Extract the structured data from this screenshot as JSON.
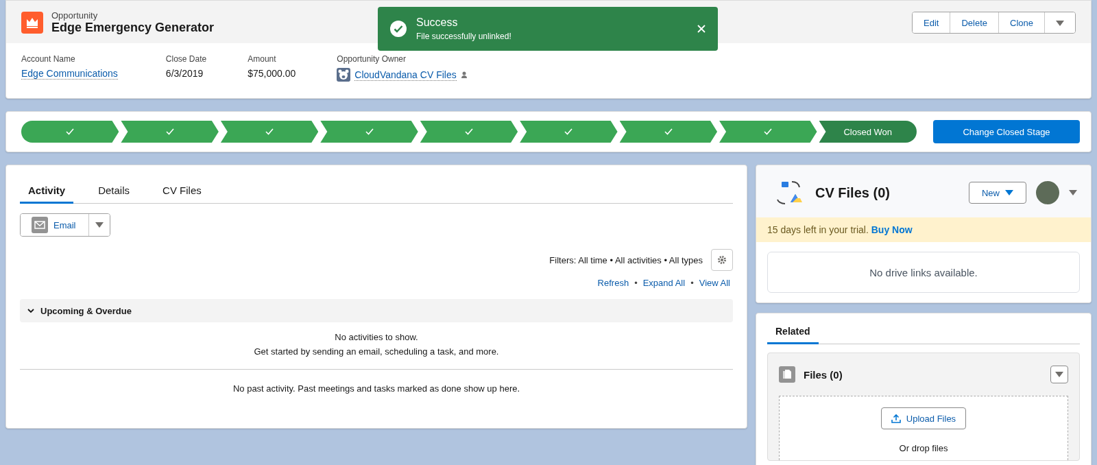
{
  "record": {
    "type": "Opportunity",
    "title": "Edge Emergency Generator",
    "actions": [
      "Edit",
      "Delete",
      "Clone"
    ]
  },
  "fields": [
    {
      "label": "Account Name",
      "value": "Edge Communications",
      "kind": "link"
    },
    {
      "label": "Close Date",
      "value": "6/3/2019",
      "kind": "text"
    },
    {
      "label": "Amount",
      "value": "$75,000.00",
      "kind": "text"
    },
    {
      "label": "Opportunity Owner",
      "value": "CloudVandana CV Files",
      "kind": "owner"
    }
  ],
  "toast": {
    "title": "Success",
    "message": "File successfully unlinked!"
  },
  "path": {
    "stages": [
      {
        "selected": false
      },
      {
        "selected": false
      },
      {
        "selected": false
      },
      {
        "selected": false
      },
      {
        "selected": false
      },
      {
        "selected": false
      },
      {
        "selected": false
      },
      {
        "selected": false
      },
      {
        "label": "Closed Won",
        "selected": true
      }
    ],
    "button": "Change Closed Stage"
  },
  "activity": {
    "tabs": [
      {
        "label": "Activity",
        "selected": true
      },
      {
        "label": "Details",
        "selected": false
      },
      {
        "label": "CV Files",
        "selected": false
      }
    ],
    "email_button": "Email",
    "filters": "Filters: All time • All activities • All types",
    "links": [
      "Refresh",
      "Expand All",
      "View All"
    ],
    "link_separator": "•",
    "section": {
      "title": "Upcoming & Overdue",
      "expanded": true
    },
    "empty_lines": [
      "No activities to show.",
      "Get started by sending an email, scheduling a task, and more."
    ],
    "past": "No past activity. Past meetings and tasks marked as done show up here."
  },
  "cv_files": {
    "title": "CV Files (0)",
    "new_button": "New",
    "trial": "15 days left in your trial.",
    "trial_link": "Buy Now",
    "empty": "No drive links available."
  },
  "related": {
    "tabs": [
      {
        "label": "Related",
        "selected": true
      }
    ],
    "files_title": "Files (0)",
    "upload": "Upload Files",
    "drop": "Or drop files"
  }
}
